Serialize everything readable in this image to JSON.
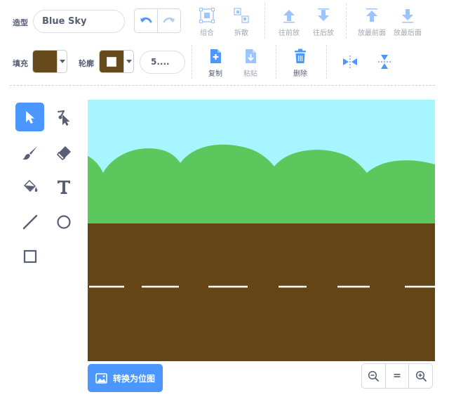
{
  "costume": {
    "label": "造型",
    "name": "Blue Sky"
  },
  "toolbar_top": {
    "group": "组合",
    "ungroup": "拆散",
    "forward": "往前放",
    "backward": "往后放",
    "front": "放最前面",
    "back": "放最后面"
  },
  "fill": {
    "label": "填充",
    "color": "#664a1b"
  },
  "outline": {
    "label": "轮廓",
    "color": "#ffffff",
    "width": "5...."
  },
  "toolbar_bottom": {
    "copy": "复制",
    "paste": "粘贴",
    "delete": "删除"
  },
  "tools": [
    "select",
    "reshape",
    "brush",
    "eraser",
    "fill",
    "text",
    "line",
    "circle",
    "rectangle"
  ],
  "canvas_colors": {
    "sky": "#a7f5ff",
    "grass": "#5cc75c",
    "ground": "#644516",
    "road_line": "#ffffff"
  },
  "convert_button": "转换为位图",
  "zoom": {
    "reset": "="
  }
}
